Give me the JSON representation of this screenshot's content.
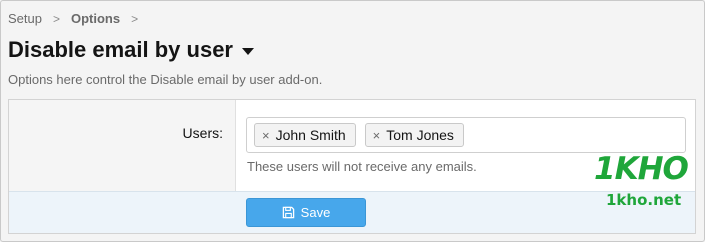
{
  "breadcrumb": {
    "items": [
      "Setup",
      "Options"
    ],
    "separator": ">"
  },
  "page": {
    "title": "Disable email by user",
    "description": "Options here control the Disable email by user add-on."
  },
  "form": {
    "users_label": "Users:",
    "users": [
      {
        "name": "John Smith",
        "remove_glyph": "×"
      },
      {
        "name": "Tom Jones",
        "remove_glyph": "×"
      }
    ],
    "users_hint": "These users will not receive any emails.",
    "save_label": "Save",
    "save_icon": "floppy-disk-icon"
  },
  "watermark": {
    "logo_text": "1KHO",
    "site_text": "1kho.net"
  },
  "colors": {
    "accent": "#47a7eb",
    "footer_bg": "#edf4fa",
    "watermark": "#1fa63a"
  }
}
